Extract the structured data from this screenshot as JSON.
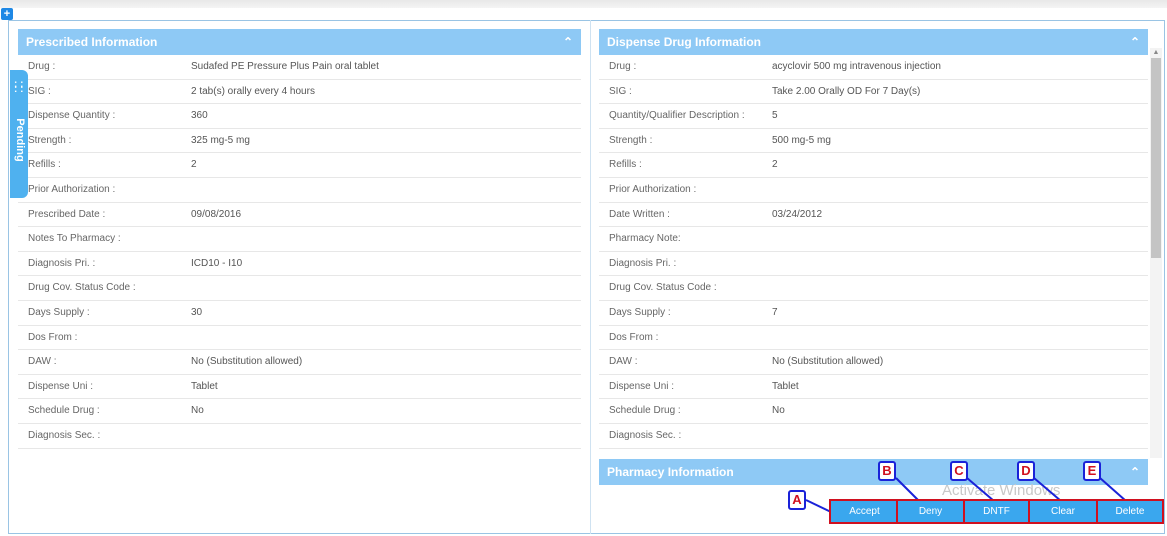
{
  "window": {
    "expand_icon": "plus-icon"
  },
  "side_tab": {
    "label": "Pending",
    "icon": "drag-dots-icon"
  },
  "prescribed": {
    "title": "Prescribed Information",
    "collapse_icon": "chevron-up-icon",
    "rows": [
      {
        "label": "Drug :",
        "value": "Sudafed PE Pressure Plus Pain oral tablet"
      },
      {
        "label": "SIG :",
        "value": "2 tab(s) orally every 4 hours"
      },
      {
        "label": "Dispense Quantity :",
        "value": "360"
      },
      {
        "label": "Strength :",
        "value": "325 mg-5 mg"
      },
      {
        "label": "Refills :",
        "value": "2"
      },
      {
        "label": "Prior Authorization :",
        "value": ""
      },
      {
        "label": "Prescribed Date :",
        "value": "09/08/2016"
      },
      {
        "label": "Notes To Pharmacy :",
        "value": ""
      },
      {
        "label": "Diagnosis Pri. :",
        "value": "ICD10 - I10"
      },
      {
        "label": "Drug Cov. Status Code :",
        "value": ""
      },
      {
        "label": "Days Supply :",
        "value": "30"
      },
      {
        "label": "Dos From :",
        "value": ""
      },
      {
        "label": "DAW :",
        "value": "No (Substitution allowed)"
      },
      {
        "label": "Dispense Uni :",
        "value": "Tablet"
      },
      {
        "label": "Schedule Drug :",
        "value": "No"
      },
      {
        "label": "Diagnosis Sec. :",
        "value": ""
      }
    ]
  },
  "dispense": {
    "title": "Dispense Drug Information",
    "collapse_icon": "chevron-up-icon",
    "rows": [
      {
        "label": "Drug :",
        "value": "acyclovir 500 mg intravenous injection"
      },
      {
        "label": "SIG :",
        "value": "Take 2.00 Orally OD For 7 Day(s)"
      },
      {
        "label": "Quantity/Qualifier Description :",
        "value": "5"
      },
      {
        "label": "Strength :",
        "value": "500 mg-5 mg"
      },
      {
        "label": "Refills :",
        "value": "2"
      },
      {
        "label": "Prior Authorization :",
        "value": ""
      },
      {
        "label": "Date Written :",
        "value": "03/24/2012"
      },
      {
        "label": "Pharmacy Note:",
        "value": ""
      },
      {
        "label": "Diagnosis Pri. :",
        "value": ""
      },
      {
        "label": "Drug Cov. Status Code :",
        "value": ""
      },
      {
        "label": "Days Supply :",
        "value": "7"
      },
      {
        "label": "Dos From :",
        "value": ""
      },
      {
        "label": "DAW :",
        "value": "No (Substitution allowed)"
      },
      {
        "label": "Dispense Uni :",
        "value": "Tablet"
      },
      {
        "label": "Schedule Drug :",
        "value": "No"
      },
      {
        "label": "Diagnosis Sec. :",
        "value": ""
      }
    ]
  },
  "pharmacy": {
    "title": "Pharmacy Information",
    "collapse_icon": "chevron-up-icon"
  },
  "watermark": "Activate Windows",
  "actions": {
    "accept": "Accept",
    "deny": "Deny",
    "dntf": "DNTF",
    "clear": "Clear",
    "delete": "Delete"
  },
  "markers": {
    "a": "A",
    "b": "B",
    "c": "C",
    "d": "D",
    "e": "E"
  },
  "colors": {
    "header": "#8ec9f5",
    "button": "#3aa7ee",
    "highlight": "#d0101f",
    "marker_border": "#1a22d8"
  }
}
